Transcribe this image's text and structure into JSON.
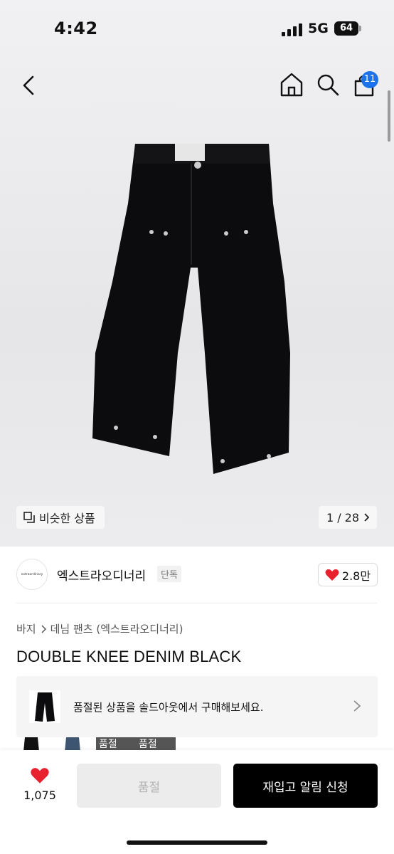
{
  "status_bar": {
    "time": "4:42",
    "network": "5G",
    "battery": "64"
  },
  "header": {
    "cart_count": "11",
    "icons": [
      "back-icon",
      "home-icon",
      "search-icon",
      "cart-icon"
    ]
  },
  "gallery": {
    "similar_label": "비슷한 상품",
    "pager": "1 / 28"
  },
  "brand": {
    "logo_text": "extraordinary",
    "name": "엑스트라오디너리",
    "tag": "단독",
    "likes": "2.8만"
  },
  "breadcrumb": {
    "level1": "바지",
    "level2": "데님 팬츠 (엑스트라오디너리)"
  },
  "product": {
    "title": "DOUBLE KNEE DENIM BLACK"
  },
  "soldout_banner": {
    "text": "품절된 상품을 솔드아웃에서 구매해보세요."
  },
  "variants": {
    "soldout_label_1": "품절",
    "soldout_label_2": "품절"
  },
  "bottom_bar": {
    "wish_count": "1,075",
    "soldout_button": "품절",
    "restock_button": "재입고 알림 신청"
  },
  "colors": {
    "accent_blue": "#1a73e8",
    "heart_red": "#e8212f",
    "primary_black": "#000000"
  }
}
